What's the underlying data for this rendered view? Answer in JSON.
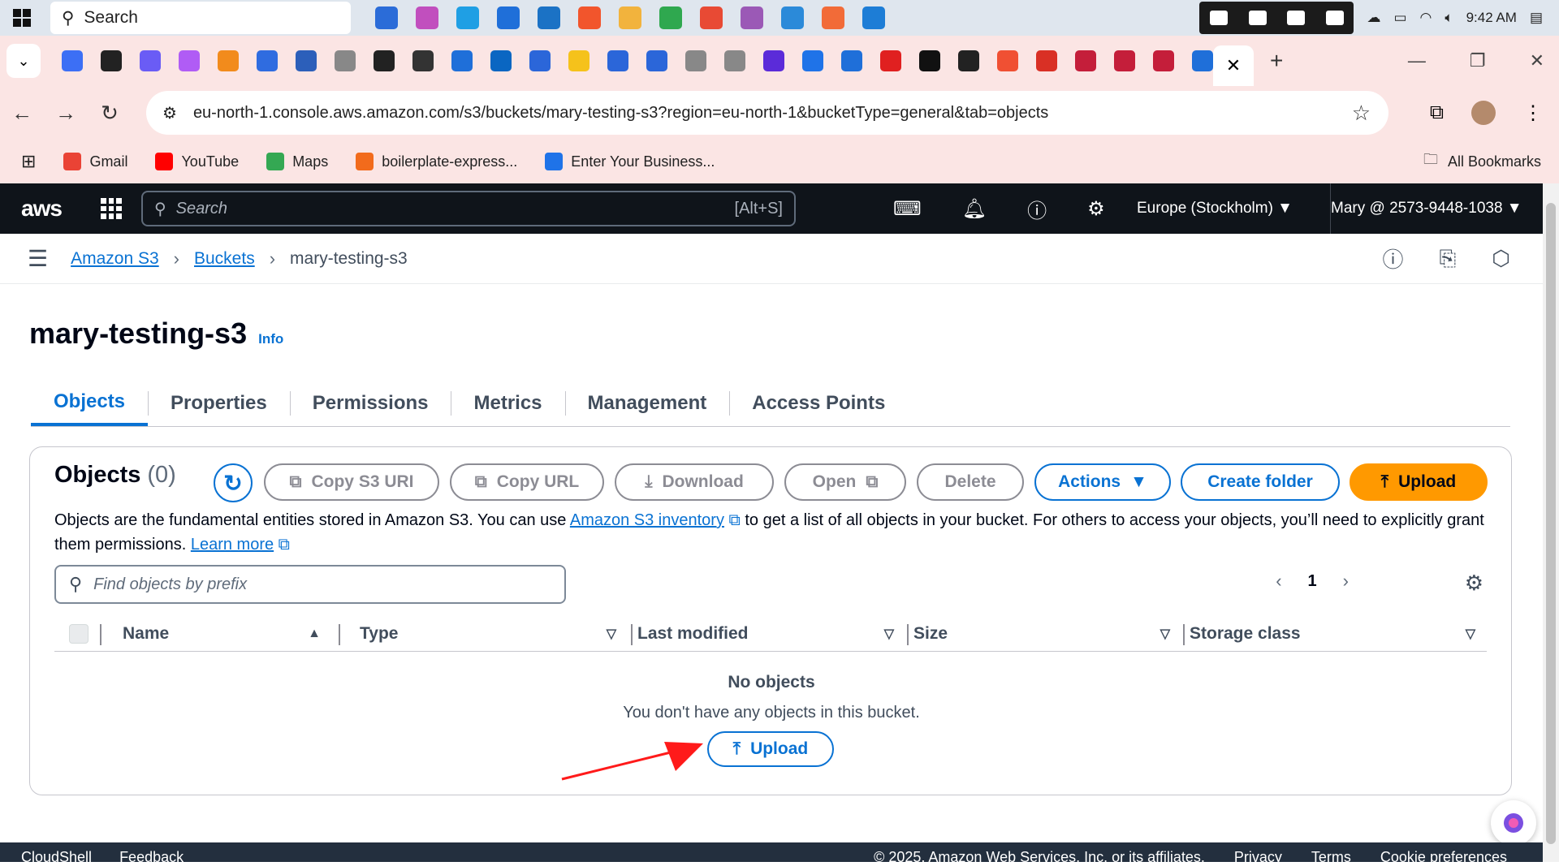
{
  "taskbar": {
    "search_label": "Search",
    "time": "9:42 AM",
    "apps": [
      "#2b6cd8",
      "#c14fbe",
      "#1f9fe4",
      "#1f6fd9",
      "#1b72c5",
      "#f2552c",
      "#f2b33d",
      "#2fa84f",
      "#e84a34",
      "#9b59b6",
      "#2b8ad9",
      "#f26b38",
      "#1d7dd6"
    ]
  },
  "browser": {
    "tab_favicons": [
      "#3c6ff5",
      "#222222",
      "#6a5cf5",
      "#b05cf5",
      "#f28b1c",
      "#2f6ce0",
      "#2c5fba",
      "#888888",
      "#222222",
      "#333333",
      "#1f6fd9",
      "#0a66c2",
      "#2b66d9",
      "#f5c21b",
      "#2b66d9",
      "#2b66d9",
      "#888888",
      "#888888",
      "#5b2bd9",
      "#1f73e8",
      "#1f6fd9",
      "#e02020",
      "#111111",
      "#222222",
      "#f05033",
      "#d93025",
      "#c41e3a",
      "#c41e3a",
      "#c41e3a",
      "#1f6fd9"
    ],
    "active_tab_close": "✕",
    "new_tab": "+",
    "url": "eu-north-1.console.aws.amazon.com/s3/buckets/mary-testing-s3?region=eu-north-1&bucketType=general&tab=objects",
    "bookmarks": [
      {
        "label": "Gmail",
        "color": "#ea4335"
      },
      {
        "label": "YouTube",
        "color": "#ff0000"
      },
      {
        "label": "Maps",
        "color": "#34a853"
      },
      {
        "label": "boilerplate-express...",
        "color": "#f26b1c"
      },
      {
        "label": "Enter Your Business...",
        "color": "#1f73e8"
      }
    ],
    "all_bookmarks": "All Bookmarks"
  },
  "aws": {
    "logo": "aws",
    "search_placeholder": "Search",
    "search_shortcut": "[Alt+S]",
    "region": "Europe (Stockholm) ▼",
    "account": "Mary @ 2573-9448-1038 ▼"
  },
  "breadcrumb": {
    "items": [
      "Amazon S3",
      "Buckets"
    ],
    "current": "mary-testing-s3"
  },
  "page": {
    "title": "mary-testing-s3",
    "info": "Info",
    "tabs": [
      "Objects",
      "Properties",
      "Permissions",
      "Metrics",
      "Management",
      "Access Points"
    ]
  },
  "objects_panel": {
    "title": "Objects",
    "count": "(0)",
    "buttons": {
      "copy_uri": "Copy S3 URI",
      "copy_url": "Copy URL",
      "download": "Download",
      "open": "Open",
      "delete": "Delete",
      "actions": "Actions",
      "create_folder": "Create folder",
      "upload": "Upload"
    },
    "description_1": "Objects are the fundamental entities stored in Amazon S3. You can use ",
    "inventory_link": "Amazon S3 inventory",
    "description_2": " to get a list of all objects in your bucket. For others to access your objects, you’ll need to explicitly grant them permissions. ",
    "learn_more": "Learn more",
    "filter_placeholder": "Find objects by prefix",
    "page_number": "1",
    "columns": [
      "Name",
      "Type",
      "Last modified",
      "Size",
      "Storage class"
    ],
    "empty_title": "No objects",
    "empty_text": "You don't have any objects in this bucket.",
    "empty_upload": "Upload"
  },
  "footer": {
    "left": [
      "CloudShell",
      "Feedback"
    ],
    "copyright": "© 2025, Amazon Web Services, Inc. or its affiliates.",
    "right": [
      "Privacy",
      "Terms",
      "Cookie preferences"
    ]
  },
  "colors": {
    "aws_nav": "#0f141a",
    "link_blue": "#0972d3",
    "upload_orange": "#ff9900",
    "browser_chrome": "#fbe5e4",
    "annotation_arrow": "#ff1a1a"
  }
}
